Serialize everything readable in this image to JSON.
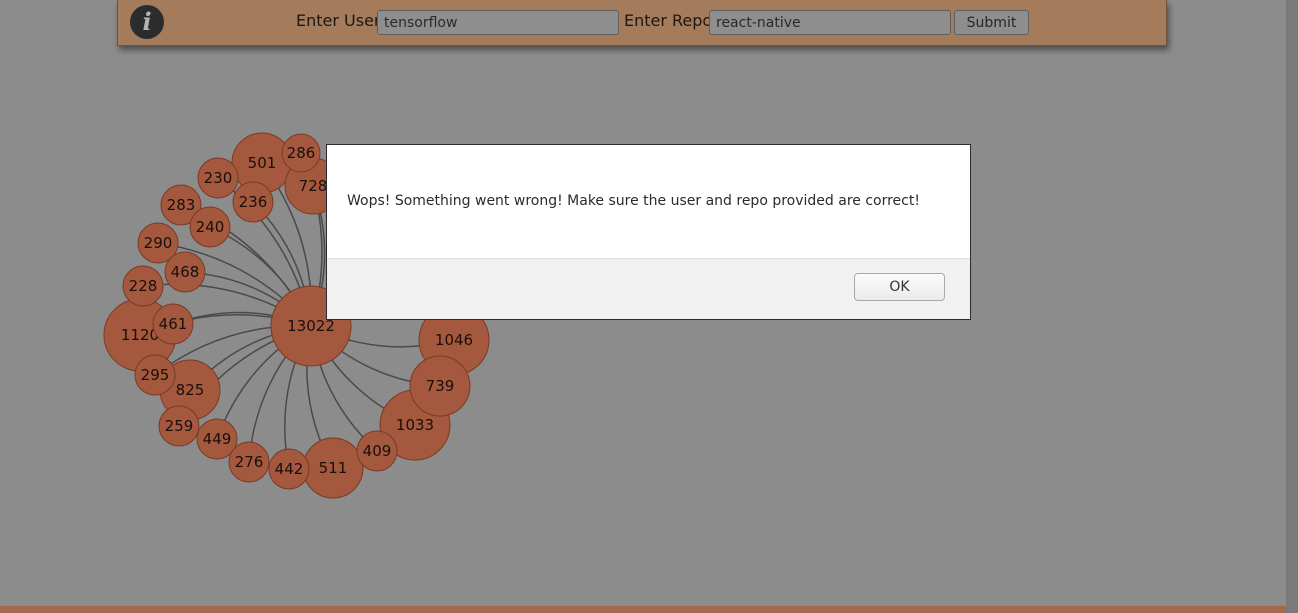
{
  "header": {
    "info_icon": "info-icon",
    "user_label": "Enter User",
    "user_value": "tensorflow",
    "repo_label": "Enter Repo",
    "repo_value": "react-native",
    "submit_label": "Submit"
  },
  "graph": {
    "center": {
      "id": "center",
      "value": "13022"
    },
    "nodes": [
      {
        "id": "n728",
        "value": "728"
      },
      {
        "id": "n501",
        "value": "501"
      },
      {
        "id": "n286",
        "value": "286"
      },
      {
        "id": "n230",
        "value": "230"
      },
      {
        "id": "n236",
        "value": "236"
      },
      {
        "id": "n283",
        "value": "283"
      },
      {
        "id": "n240",
        "value": "240"
      },
      {
        "id": "n290",
        "value": "290"
      },
      {
        "id": "n468",
        "value": "468"
      },
      {
        "id": "n228",
        "value": "228"
      },
      {
        "id": "n1120",
        "value": "1120"
      },
      {
        "id": "n461",
        "value": "461"
      },
      {
        "id": "n295",
        "value": "295"
      },
      {
        "id": "n825",
        "value": "825"
      },
      {
        "id": "n259",
        "value": "259"
      },
      {
        "id": "n449",
        "value": "449"
      },
      {
        "id": "n276",
        "value": "276"
      },
      {
        "id": "n442",
        "value": "442"
      },
      {
        "id": "n511",
        "value": "511"
      },
      {
        "id": "n409",
        "value": "409"
      },
      {
        "id": "n1033",
        "value": "1033"
      },
      {
        "id": "n739",
        "value": "739"
      },
      {
        "id": "n1046",
        "value": "1046"
      }
    ],
    "colors": {
      "node_fill": "#a4583e",
      "node_stroke": "#7a3a24",
      "link": "#4a4a4a"
    }
  },
  "dialog": {
    "message": "Wops! Something went wrong! Make sure the user and repo provided are correct!",
    "ok_label": "OK"
  }
}
